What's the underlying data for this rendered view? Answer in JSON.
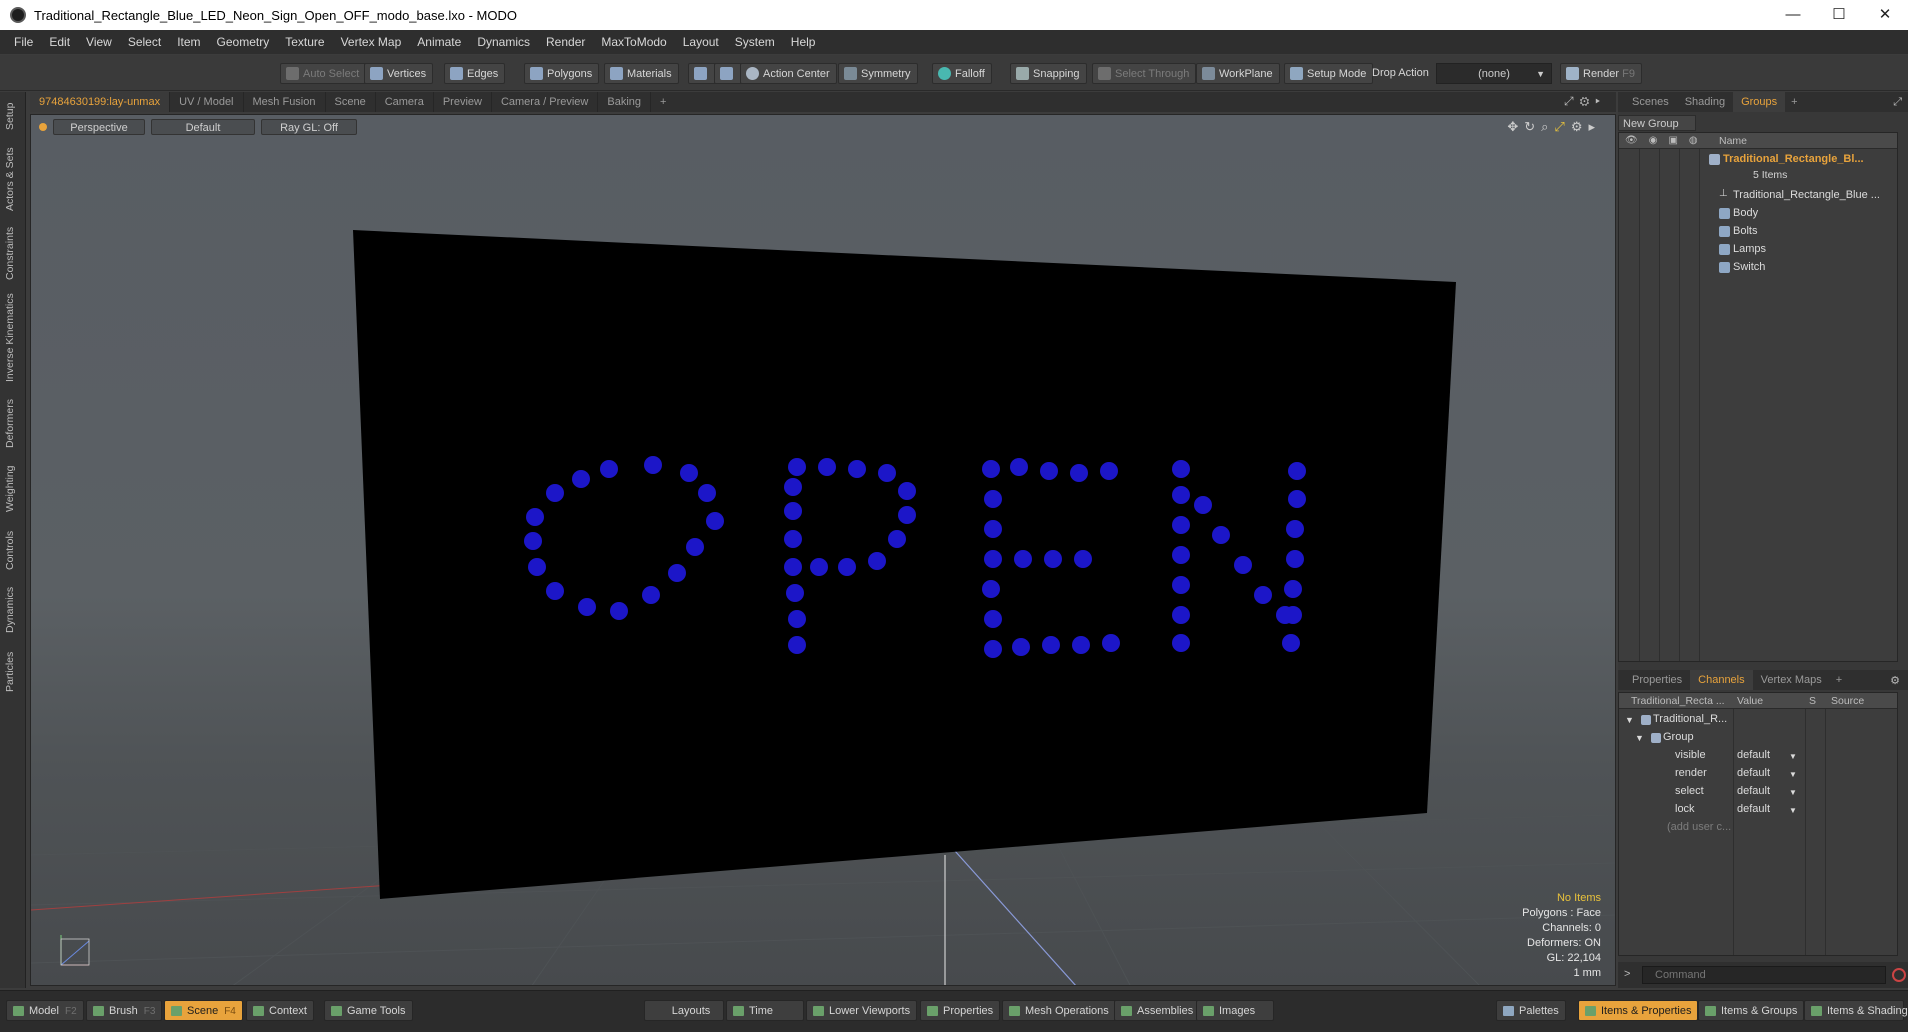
{
  "window": {
    "title": "Traditional_Rectangle_Blue_LED_Neon_Sign_Open_OFF_modo_base.lxo - MODO",
    "minimize": "—",
    "maximize": "☐",
    "close": "✕"
  },
  "menu": [
    "File",
    "Edit",
    "View",
    "Select",
    "Item",
    "Geometry",
    "Texture",
    "Vertex Map",
    "Animate",
    "Dynamics",
    "Render",
    "MaxToModo",
    "Layout",
    "System",
    "Help"
  ],
  "toolbar": {
    "auto_select": "Auto Select",
    "vertices": "Vertices",
    "edges": "Edges",
    "polygons": "Polygons",
    "materials": "Materials",
    "action_center": "Action Center",
    "symmetry": "Symmetry",
    "falloff": "Falloff",
    "snapping": "Snapping",
    "select_through": "Select Through",
    "workplane": "WorkPlane",
    "setup_mode": "Setup Mode",
    "drop_action_label": "Drop Action",
    "drop_action_value": "(none)",
    "render": "Render",
    "render_key": "F9"
  },
  "left_tabs": [
    "Setup",
    "Actors & Sets",
    "Constraints",
    "Inverse Kinematics",
    "Deformers",
    "Weighting",
    "Controls",
    "Dynamics",
    "Particles"
  ],
  "viewport_tabs": [
    "97484630199:lay-unmax",
    "UV / Model",
    "Mesh Fusion",
    "Scene",
    "Camera",
    "Preview",
    "Camera / Preview",
    "Baking",
    "+"
  ],
  "viewport": {
    "view_mode": "Perspective",
    "shading": "Default",
    "raygl": "Ray GL: Off",
    "sign_text": "OPEN",
    "info": {
      "selection": "No Items",
      "polygons": "Polygons : Face",
      "channels": "Channels: 0",
      "deformers": "Deformers: ON",
      "gl": "GL: 22,104",
      "unit": "1 mm"
    }
  },
  "right_tabs": [
    "Scenes",
    "Shading",
    "Groups",
    "+"
  ],
  "groups": {
    "new_group": "New Group",
    "name_header": "Name",
    "root": "Traditional_Rectangle_Bl...",
    "root_count": "5 Items",
    "items": [
      "Traditional_Rectangle_Blue ...",
      "Body",
      "Bolts",
      "Lamps",
      "Switch"
    ]
  },
  "props_tabs": [
    "Properties",
    "Channels",
    "Vertex Maps",
    "+"
  ],
  "channels": {
    "headers": {
      "name": "Traditional_Recta ...",
      "value": "Value",
      "s": "S",
      "source": "Source"
    },
    "tree_root": "Traditional_R...",
    "tree_group": "Group",
    "rows": [
      {
        "name": "visible",
        "value": "default"
      },
      {
        "name": "render",
        "value": "default"
      },
      {
        "name": "select",
        "value": "default"
      },
      {
        "name": "lock",
        "value": "default"
      }
    ],
    "add_user": "(add user c..."
  },
  "command": {
    "placeholder": "Command"
  },
  "bottom": {
    "model": "Model",
    "model_key": "F2",
    "brush": "Brush",
    "brush_key": "F3",
    "scene": "Scene",
    "scene_key": "F4",
    "context": "Context",
    "game_tools": "Game Tools",
    "layouts": "Layouts",
    "time": "Time",
    "lower_viewports": "Lower Viewports",
    "properties": "Properties",
    "mesh_operations": "Mesh Operations",
    "assemblies": "Assemblies",
    "images": "Images",
    "palettes": "Palettes",
    "items_properties": "Items & Properties",
    "items_groups": "Items & Groups",
    "items_shading": "Items & Shading"
  },
  "colors": {
    "accent": "#e8a33c",
    "led": "#1c16c8",
    "sign": "#000000"
  }
}
